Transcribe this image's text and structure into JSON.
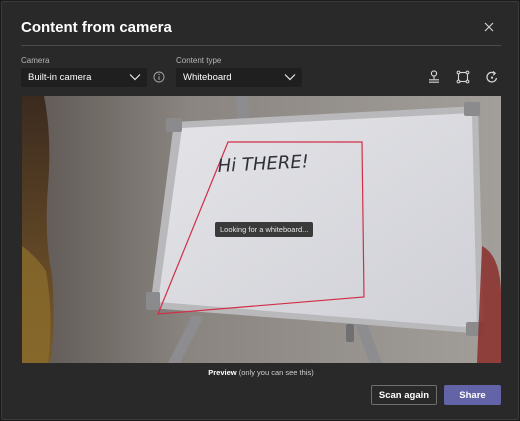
{
  "dialog": {
    "title": "Content from camera",
    "close_icon": "close-icon"
  },
  "camera": {
    "label": "Camera",
    "value": "Built-in camera",
    "info_icon": "info-icon"
  },
  "content_type": {
    "label": "Content type",
    "value": "Whiteboard"
  },
  "toolbar": {
    "icons": [
      "camera-switch-icon",
      "crop-icon",
      "rotate-icon"
    ]
  },
  "preview": {
    "status": "Looking for a whiteboard...",
    "whiteboard_text": "Hi THERE!",
    "caption_bold": "Preview",
    "caption_rest": " (only you can see this)",
    "detection_color": "#d12f48"
  },
  "actions": {
    "scan_again_label": "Scan again",
    "share_label": "Share"
  },
  "colors": {
    "primary": "#6264a7",
    "background": "#292929"
  }
}
